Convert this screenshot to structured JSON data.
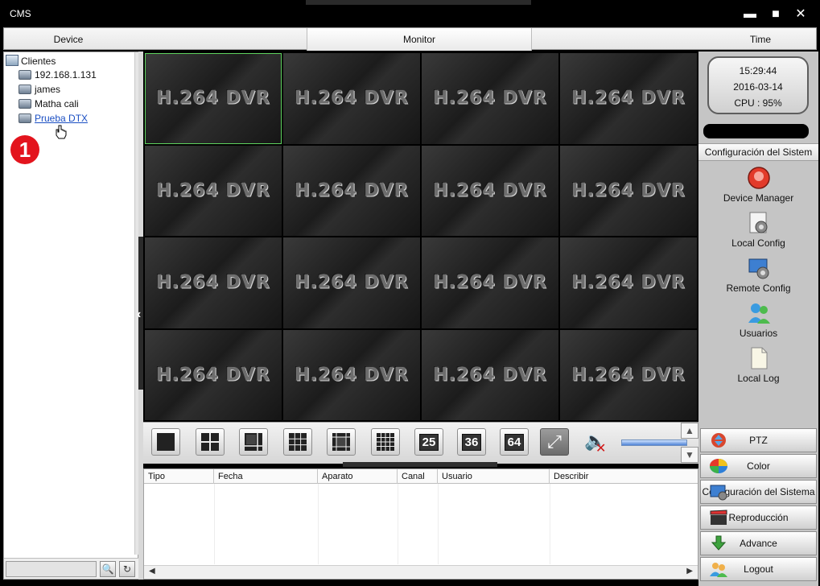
{
  "window": {
    "title": "CMS"
  },
  "tabs": [
    "Device",
    "Monitor",
    "Time"
  ],
  "tree": {
    "root": "Clientes",
    "devices": [
      "192.168.1.131",
      "james",
      "Matha cali",
      "Prueba DTX"
    ],
    "annotation_marker": "1"
  },
  "search": {
    "value": ""
  },
  "video": {
    "cell_label": "H.264 DVR",
    "channels": 16
  },
  "toolbar": {
    "layouts": [
      "25",
      "36",
      "64"
    ]
  },
  "log": {
    "columns": [
      "Tipo",
      "Fecha",
      "Aparato",
      "Canal",
      "Usuario",
      "Describir"
    ]
  },
  "status": {
    "time": "15:29:44",
    "date": "2016-03-14",
    "cpu": "CPU : 95%"
  },
  "system": {
    "header": "Configuración del Sistem",
    "items": [
      "Device Manager",
      "Local Config",
      "Remote Config",
      "Usuarios",
      "Local Log"
    ]
  },
  "buttons": [
    "PTZ",
    "Color",
    "Configuración del Sistema",
    "Reproducción",
    "Advance",
    "Logout"
  ],
  "colors": {
    "selected_cell": "#5fd35f",
    "marker": "#e3141d",
    "link": "#1b4fc3"
  }
}
